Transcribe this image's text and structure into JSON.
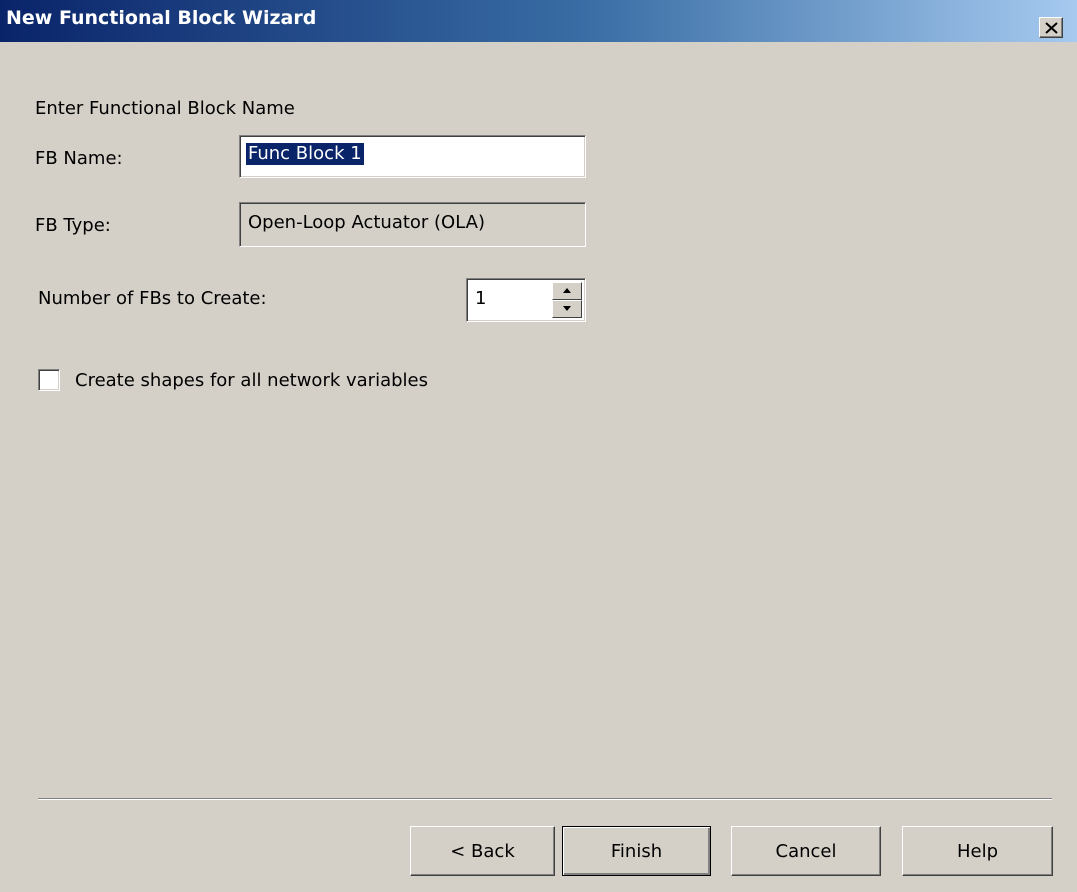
{
  "window": {
    "title": "New Functional Block Wizard",
    "close_icon": "close-icon"
  },
  "form": {
    "heading": "Enter Functional Block Name",
    "fb_name_label": "FB Name:",
    "fb_name_value": "Func Block 1",
    "fb_type_label": "FB Type:",
    "fb_type_value": "Open-Loop Actuator (OLA)",
    "count_label": "Number of FBs to Create:",
    "count_value": "1",
    "shapes_checkbox_label": "Create shapes for all network variables",
    "shapes_checkbox_checked": false
  },
  "buttons": {
    "back": "< Back",
    "finish": "Finish",
    "cancel": "Cancel",
    "help": "Help"
  },
  "colors": {
    "title_gradient_start": "#0a246a",
    "title_gradient_end": "#a6caf0",
    "face": "#d4d0c8",
    "selection": "#0a246a"
  }
}
